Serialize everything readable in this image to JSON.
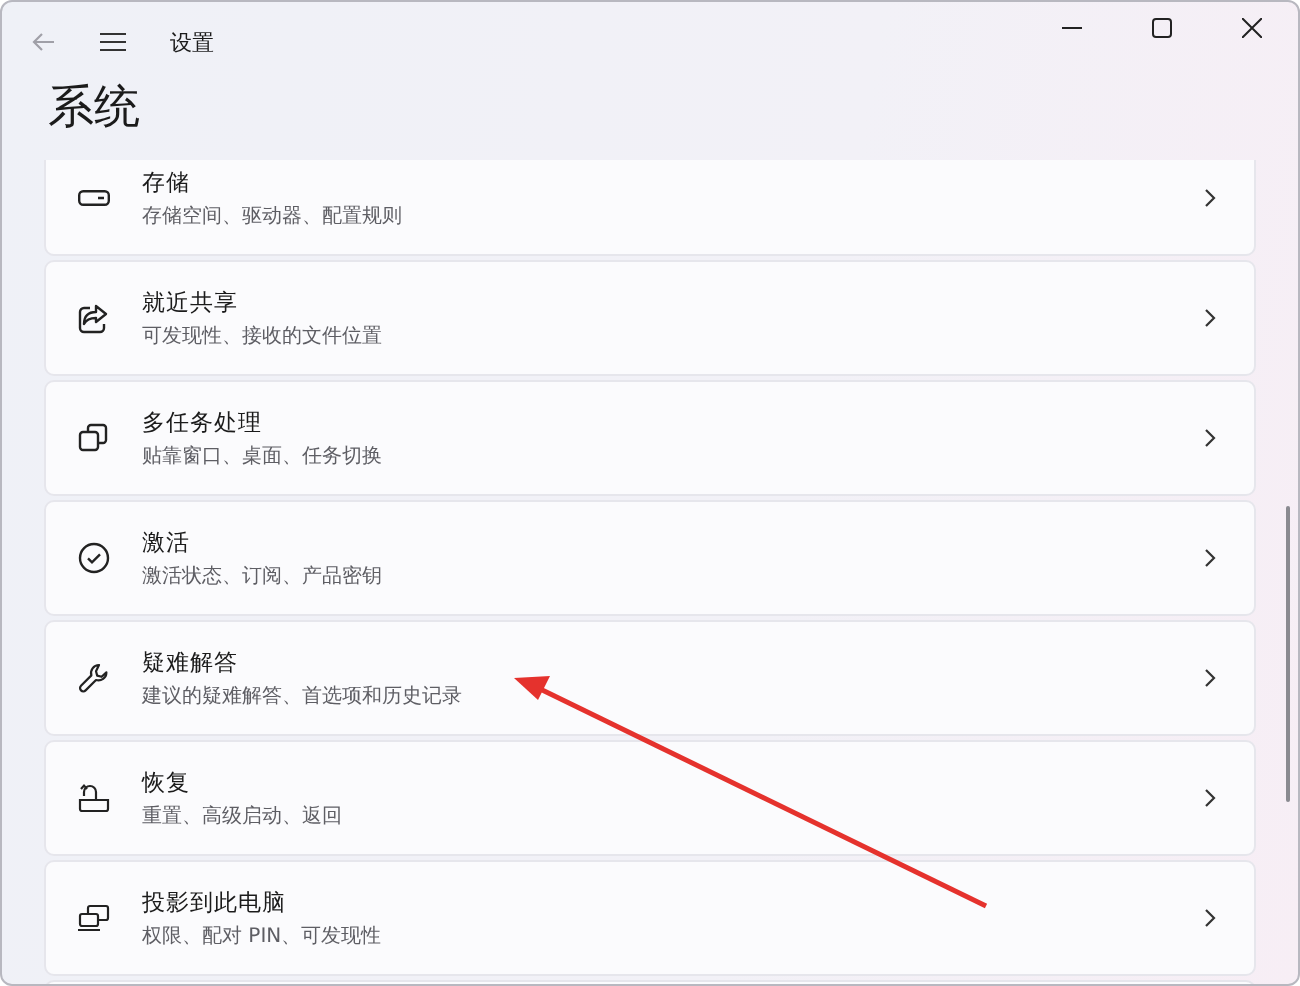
{
  "window": {
    "title": "设置"
  },
  "page_title": "系统",
  "items": [
    {
      "title": "存储",
      "subtitle": "存储空间、驱动器、配置规则"
    },
    {
      "title": "就近共享",
      "subtitle": "可发现性、接收的文件位置"
    },
    {
      "title": "多任务处理",
      "subtitle": "贴靠窗口、桌面、任务切换"
    },
    {
      "title": "激活",
      "subtitle": "激活状态、订阅、产品密钥"
    },
    {
      "title": "疑难解答",
      "subtitle": "建议的疑难解答、首选项和历史记录"
    },
    {
      "title": "恢复",
      "subtitle": "重置、高级启动、返回"
    },
    {
      "title": "投影到此电脑",
      "subtitle": "权限、配对 PIN、可发现性"
    }
  ]
}
